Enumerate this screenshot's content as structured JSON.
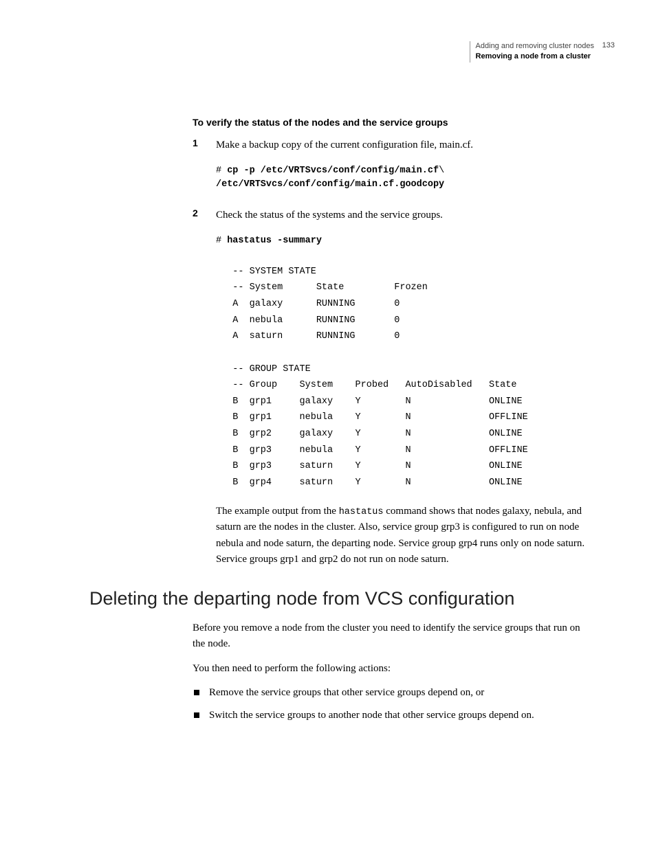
{
  "header": {
    "line1": "Adding and removing cluster nodes",
    "line2": "Removing a node from a cluster",
    "page_number": "133"
  },
  "proc_title": "To verify the status of the nodes and the service groups",
  "step1": {
    "num": "1",
    "text": "Make a backup copy of the current configuration file, main.cf.",
    "code_prefix": "# ",
    "code_cmd1": "cp -p /etc/VRTSvcs/conf/config/main.cf",
    "code_slash": "\\",
    "code_cmd2": "/etc/VRTSvcs/conf/config/main.cf.goodcopy"
  },
  "step2": {
    "num": "2",
    "text": "Check the status of the systems and the service groups.",
    "code_prefix": "# ",
    "code_cmd": "hastatus -summary",
    "output": "   -- SYSTEM STATE\n   -- System      State         Frozen\n   A  galaxy      RUNNING       0\n   A  nebula      RUNNING       0\n   A  saturn      RUNNING       0\n\n   -- GROUP STATE\n   -- Group    System    Probed   AutoDisabled   State\n   B  grp1     galaxy    Y        N              ONLINE\n   B  grp1     nebula    Y        N              OFFLINE\n   B  grp2     galaxy    Y        N              ONLINE\n   B  grp3     nebula    Y        N              OFFLINE\n   B  grp3     saturn    Y        N              ONLINE\n   B  grp4     saturn    Y        N              ONLINE",
    "expl_pre": "The example output from the ",
    "expl_mono": "hastatus",
    "expl_post": " command shows that nodes galaxy, nebula, and saturn are the nodes in the cluster. Also, service group grp3 is configured to run on node nebula and node saturn, the departing node. Service group grp4 runs only on node saturn. Service groups grp1 and grp2 do not run on node saturn."
  },
  "section": {
    "heading": "Deleting the departing node from VCS configuration",
    "para1": "Before you remove a node from the cluster you need to identify the service groups that run on the node.",
    "para2": "You then need to perform the following actions:",
    "bullets": [
      "Remove the service groups that other service groups depend on, or",
      "Switch the service groups to another node that other service groups depend on."
    ]
  }
}
